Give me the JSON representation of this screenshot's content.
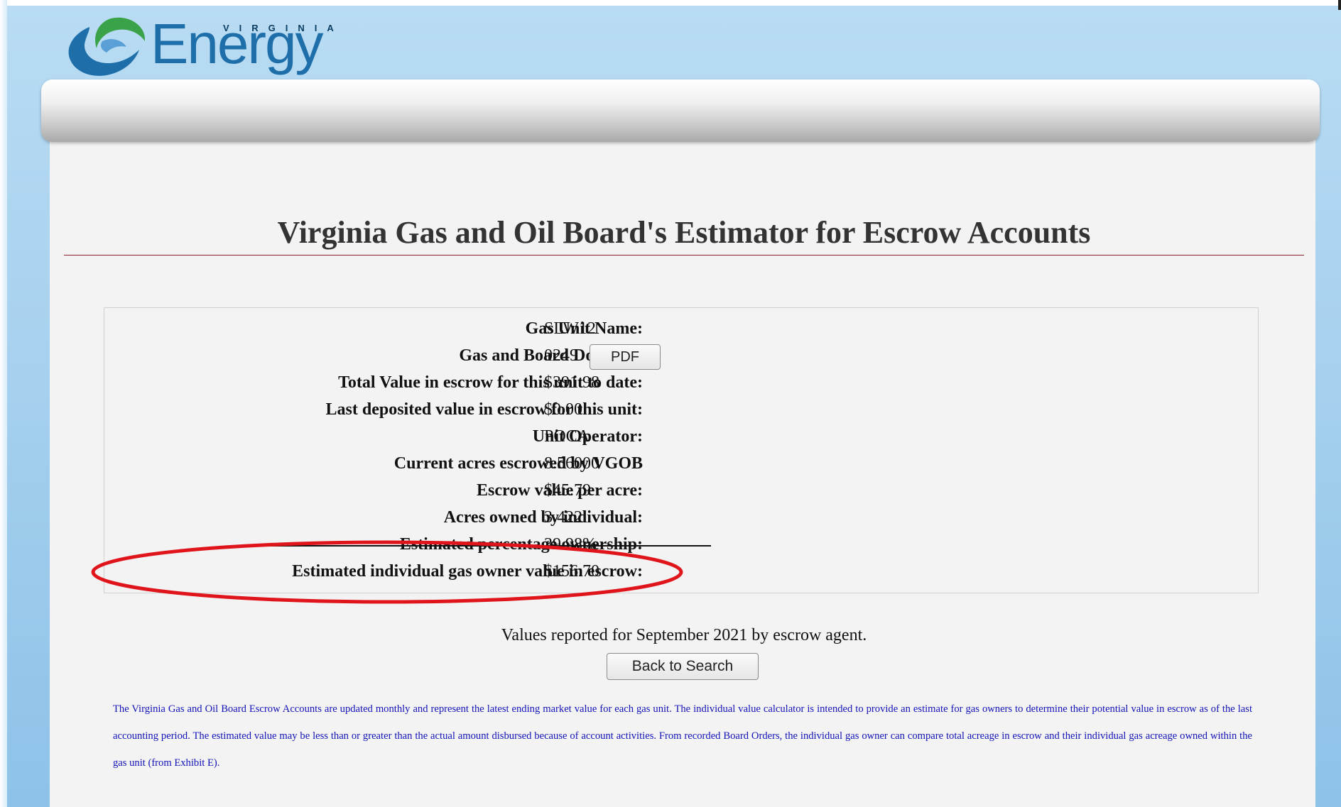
{
  "header": {
    "logo_small_text": "VIRGINIA",
    "logo_text": "Energy",
    "brand_colors": {
      "swirl_blue": "#1e6fa9",
      "swirl_green": "#3aa34a",
      "text_dark": "#0b3e63"
    }
  },
  "main": {
    "title": "Virginia Gas and Oil Board's Estimator for Escrow Accounts",
    "title_rule_color": "#8b1f2e",
    "details": [
      {
        "label": "Gas Unit Name:",
        "value": "SLW12"
      },
      {
        "label": "Gas and Board Docket #:",
        "value": "0249",
        "button": "PDF"
      },
      {
        "label": "Total Value in escrow for this unit to date:",
        "value": "$391.98"
      },
      {
        "label": "Last deposited value in escrow for this unit:",
        "value": "$0.00"
      },
      {
        "label": "Unit Operator:",
        "value": "POCA"
      },
      {
        "label": "Current acres escrowed by VGOB",
        "value": "8.56000"
      },
      {
        "label": "Escrow value per acre:",
        "value": "$45.79"
      },
      {
        "label": "Acres owned by individual:",
        "value": "3.422"
      },
      {
        "label": "Estimated percentage ownership:",
        "value": "39.98%",
        "struck_through": true
      },
      {
        "label": "Estimated individual gas owner value in escrow:",
        "value": "$156.70",
        "highlighted": true
      }
    ],
    "highlight_color": "#e0151b",
    "reported_text": "Values reported for September 2021 by escrow agent.",
    "back_button": "Back to Search",
    "disclaimer": "The Virginia Gas and Oil Board Escrow Accounts are updated monthly and represent the latest ending market value for each gas unit. The individual value calculator is intended to provide an estimate for gas owners to determine their potential value in escrow as of the last accounting period. The estimated value may be less than or greater than the actual amount disbursed because of account activities. From recorded Board Orders, the individual gas owner can compare total acreage in escrow and their individual gas acreage owned within the gas unit (from Exhibit E).",
    "disclaimer_color": "#1212b8"
  }
}
